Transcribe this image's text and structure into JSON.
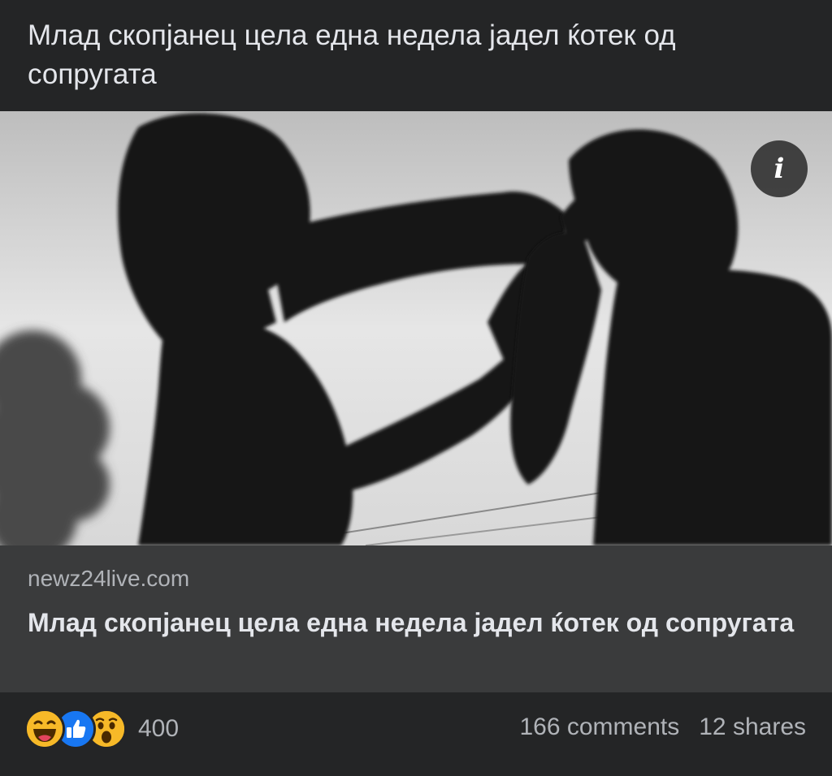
{
  "post": {
    "text": "Млад скопјанец цела една недела јадел ќотек од сопругата"
  },
  "link_preview": {
    "domain": "newz24live.com",
    "title": "Млад скопјанец цела една недела јадел ќотек од сопругата",
    "info_icon": "info-icon",
    "image_description_icon": "photo"
  },
  "footer": {
    "reactions": [
      "haha",
      "like",
      "wow"
    ],
    "reaction_count": "400",
    "comments": "166 comments",
    "shares": "12 shares"
  },
  "colors": {
    "background": "#242526",
    "preview_meta_bg": "#3a3b3c",
    "text_primary": "#e4e6eb",
    "text_secondary": "#b0b3b8",
    "like_blue": "#1877f2",
    "emoji_yellow": "#f7b928"
  }
}
